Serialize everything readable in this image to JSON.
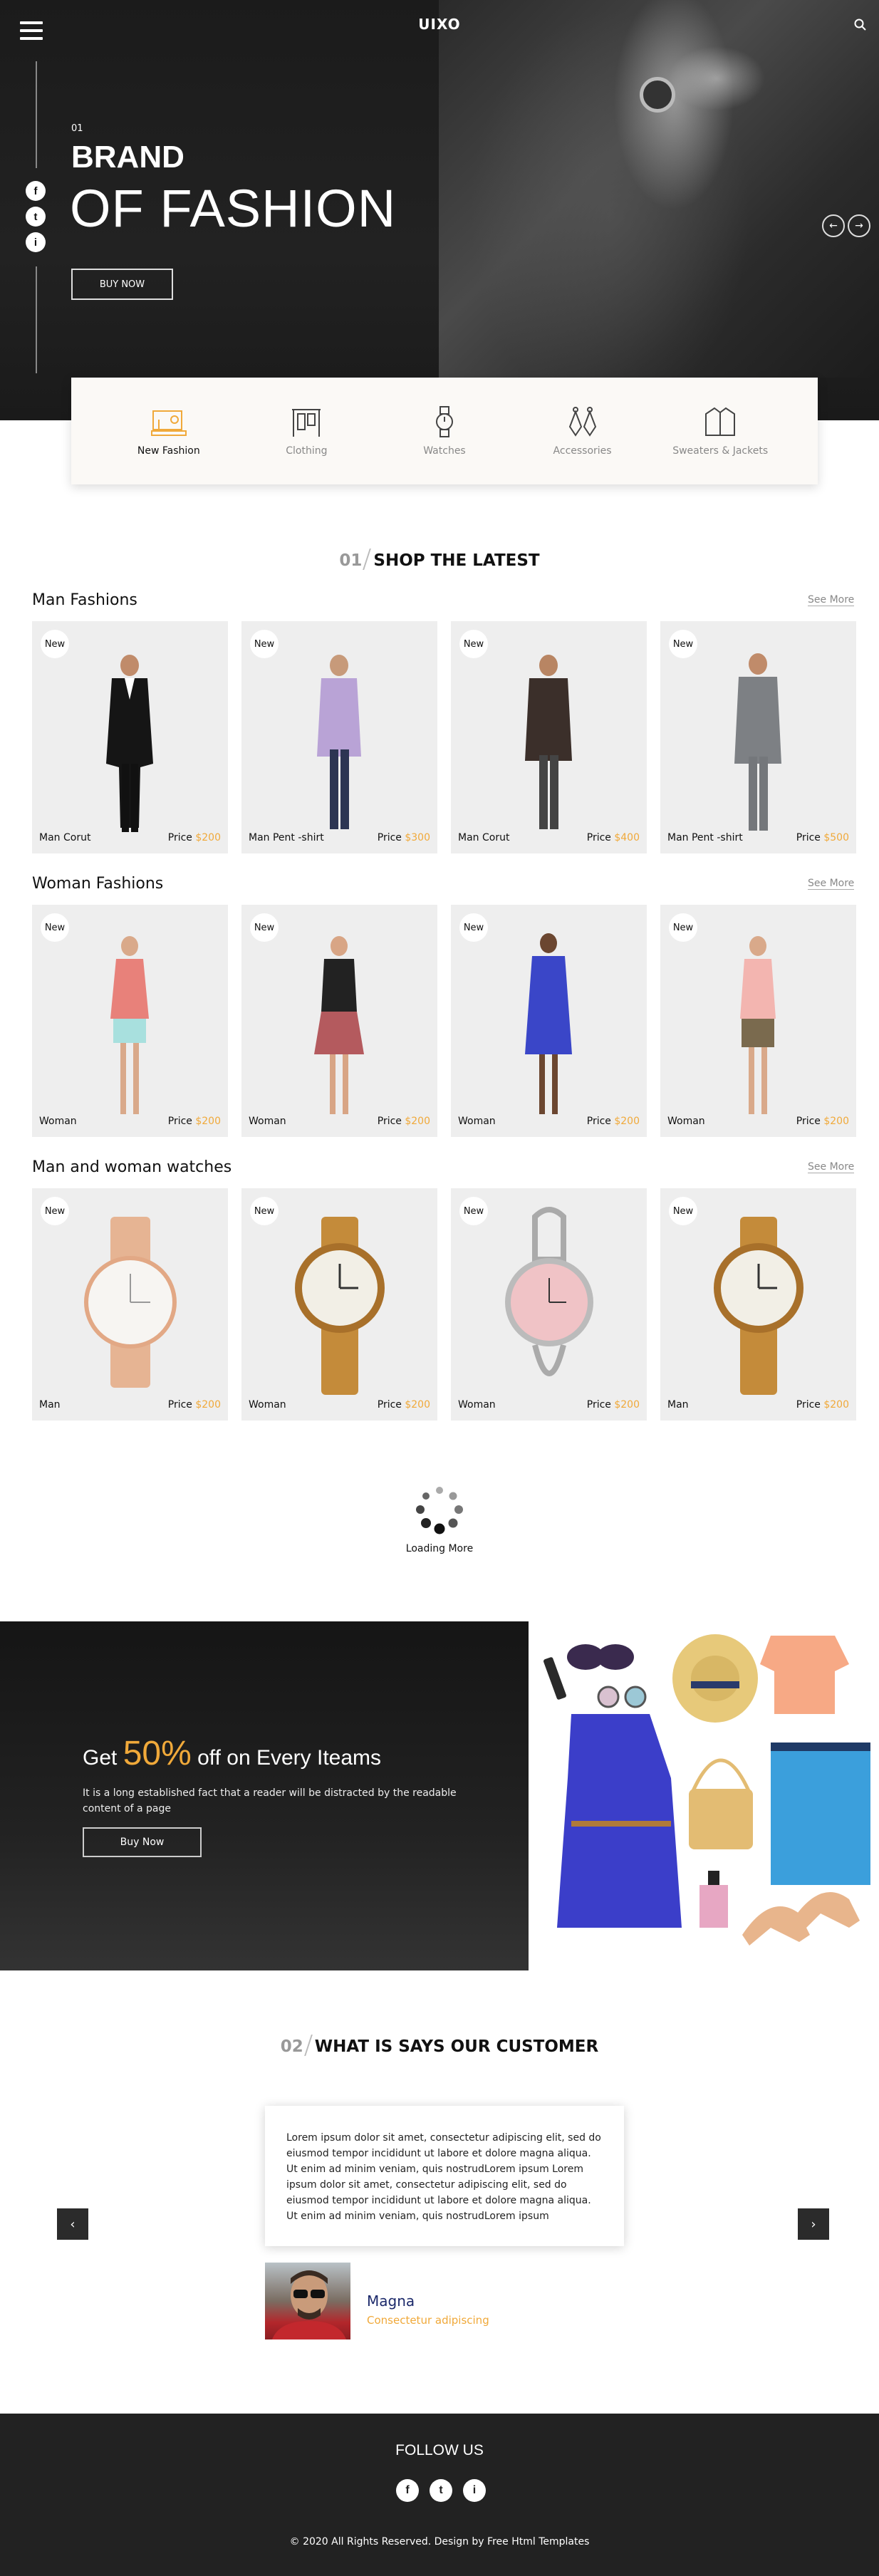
{
  "header": {
    "logo": "UIXO"
  },
  "hero": {
    "slide_number": "01",
    "title_line1": "BRAND",
    "title_line2": "OF FASHION",
    "button_label": "BUY NOW",
    "social": [
      "f",
      "t",
      "i"
    ]
  },
  "categories": [
    {
      "label": "New Fashion",
      "icon": "sewing-machine-icon",
      "active": true
    },
    {
      "label": "Clothing",
      "icon": "clothes-rack-icon",
      "active": false
    },
    {
      "label": "Watches",
      "icon": "watch-icon",
      "active": false
    },
    {
      "label": "Accessories",
      "icon": "earrings-icon",
      "active": false
    },
    {
      "label": "Sweaters & Jackets",
      "icon": "jacket-icon",
      "active": false
    }
  ],
  "shop_section": {
    "number": "01",
    "title": "SHOP THE LATEST"
  },
  "see_more": "See More",
  "badge": "New",
  "price_label": "Price",
  "rows": [
    {
      "title": "Man Fashions",
      "items": [
        {
          "name": "Man Corut",
          "price": "$200",
          "figure": "man-suit"
        },
        {
          "name": "Man Pent -shirt",
          "price": "$300",
          "figure": "man-shirt"
        },
        {
          "name": "Man Corut",
          "price": "$400",
          "figure": "man-jacket"
        },
        {
          "name": "Man Pent -shirt",
          "price": "$500",
          "figure": "man-grey"
        }
      ]
    },
    {
      "title": "Woman Fashions",
      "items": [
        {
          "name": "Woman",
          "price": "$200",
          "figure": "woman-red"
        },
        {
          "name": "Woman",
          "price": "$200",
          "figure": "woman-skirt"
        },
        {
          "name": "Woman",
          "price": "$200",
          "figure": "woman-blue"
        },
        {
          "name": "Woman",
          "price": "$200",
          "figure": "woman-pink"
        }
      ]
    },
    {
      "title": "Man and woman watches",
      "items": [
        {
          "name": "Man",
          "price": "$200",
          "figure": "watch-rose"
        },
        {
          "name": "Woman",
          "price": "$200",
          "figure": "watch-gold"
        },
        {
          "name": "Woman",
          "price": "$200",
          "figure": "watch-silver"
        },
        {
          "name": "Man",
          "price": "$200",
          "figure": "watch-gold"
        }
      ]
    }
  ],
  "loading": {
    "text": "Loading More"
  },
  "promo": {
    "prefix": "Get ",
    "percent": "50%",
    "suffix": " off on Every Iteams",
    "text": "It is a long established fact that a reader will be distracted by the readable content of a page",
    "button_label": "Buy Now"
  },
  "testimonial_section": {
    "number": "02",
    "title": "WHAT IS SAYS OUR CUSTOMER"
  },
  "testimonial": {
    "text": "Lorem ipsum dolor sit amet, consectetur adipiscing elit, sed do eiusmod tempor incididunt ut labore et dolore magna aliqua. Ut enim ad minim veniam, quis nostrudLorem ipsum Lorem ipsum dolor sit amet, consectetur adipiscing elit, sed do eiusmod tempor incididunt ut labore et dolore magna aliqua. Ut enim ad minim veniam, quis nostrudLorem ipsum",
    "name": "Magna",
    "subtitle": "Consectetur adipiscing",
    "prev": "‹",
    "next": "›"
  },
  "footer": {
    "follow_title": "FOLLOW US",
    "social": [
      "f",
      "t",
      "i"
    ],
    "copyright": "© 2020 All Rights Reserved. Design by Free Html Templates"
  },
  "colors": {
    "accent": "#f0a93a",
    "dark": "#222222",
    "card": "#eeeeee"
  }
}
